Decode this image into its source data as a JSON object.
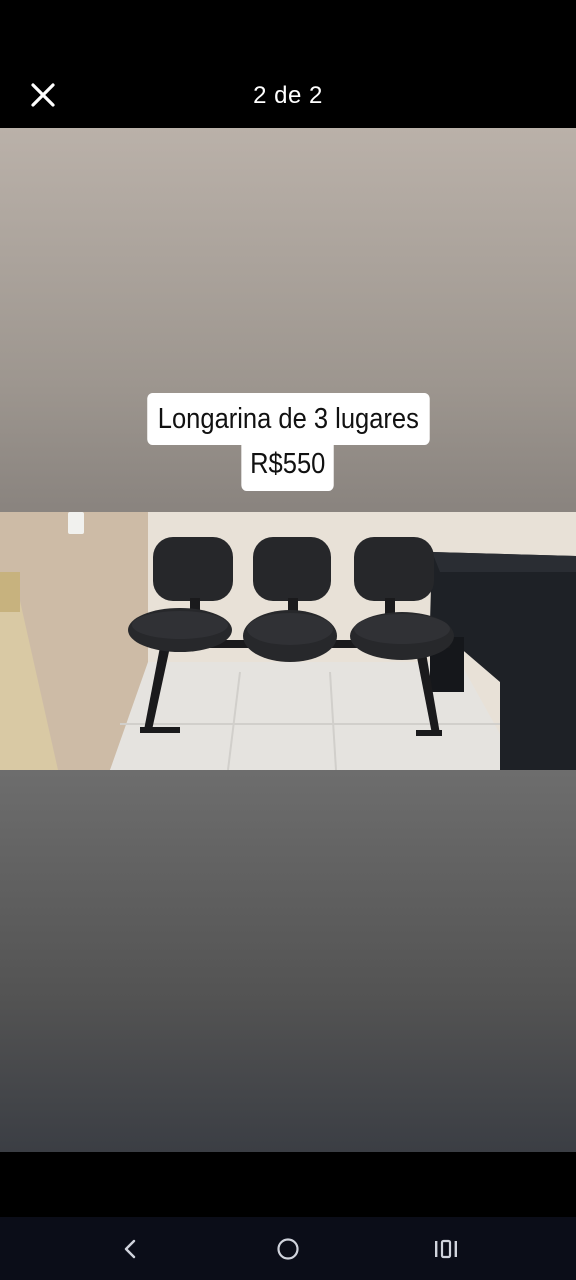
{
  "viewer": {
    "counter": "2 de 2",
    "close_icon": "close-icon"
  },
  "story": {
    "caption_line1": "Longarina de 3 lugares",
    "caption_line2": "R$550",
    "photo_subject": "three-seat black office bench"
  },
  "navbar": {
    "back_icon": "chevron-left-icon",
    "home_icon": "circle-home-icon",
    "recents_icon": "recents-icon"
  },
  "colors": {
    "background": "#000000",
    "nav_background": "#0b0d18",
    "text": "#ffffff"
  }
}
